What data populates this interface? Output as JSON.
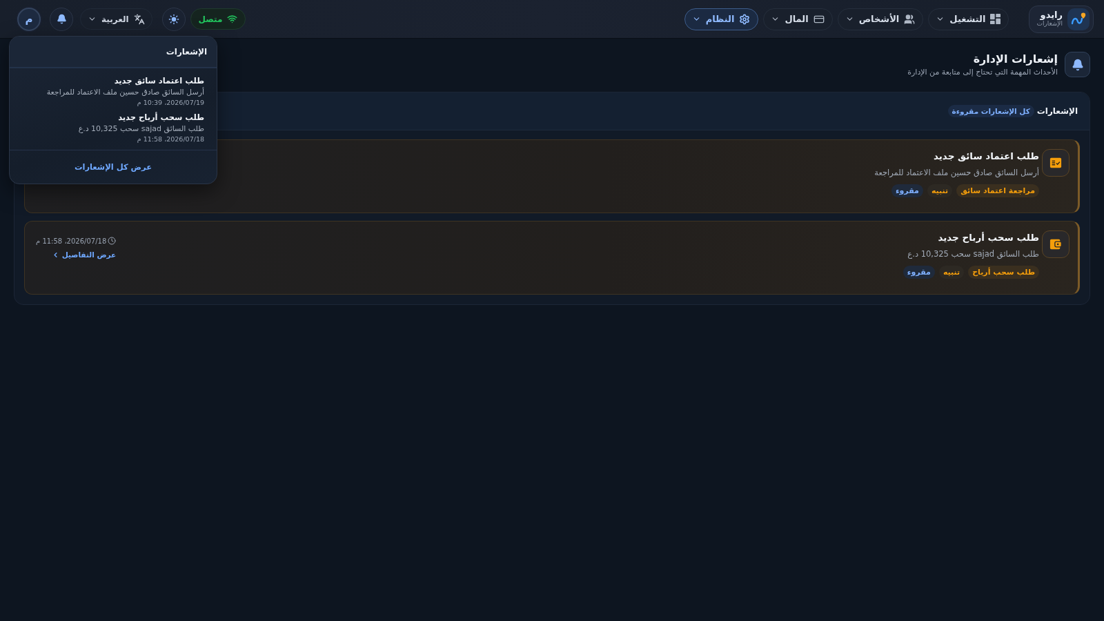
{
  "topbar": {
    "brand": {
      "name": "رايدو",
      "subtitle": "الإشعارات"
    },
    "nav": [
      {
        "label": "التشغيل",
        "selected": false
      },
      {
        "label": "الأشخاص",
        "selected": false
      },
      {
        "label": "المال",
        "selected": false
      },
      {
        "label": "النظام",
        "selected": true
      }
    ],
    "status": {
      "label": "متصل"
    },
    "language": {
      "label": "العربية"
    },
    "avatar": {
      "initial": "م"
    }
  },
  "notifications_menu": {
    "title": "الإشعارات",
    "items": [
      {
        "title": "طلب اعتماد سائق جديد",
        "message": "أرسل السائق صادق حسين ملف الاعتماد للمراجعة",
        "time": "2026/07/19، 10:39 م"
      },
      {
        "title": "طلب سحب أرباح جديد",
        "message": "طلب السائق sajad سحب 10,325 د.ع",
        "time": "2026/07/18، 11:58 م"
      }
    ],
    "footer_link": "عرض كل الإشعارات"
  },
  "page_header": {
    "title": "إشعارات الإدارة",
    "subtitle": "الأحداث المهمة التي تحتاج إلى متابعة من الإدارة"
  },
  "panel": {
    "title": "الإشعارات",
    "badge": "كل الإشعارات مقروءة",
    "notifications": [
      {
        "kind": "approval",
        "title": "طلب اعتماد سائق جديد",
        "message": "أرسل السائق صادق حسين ملف الاعتماد للمراجعة",
        "tags": [
          {
            "kind": "category",
            "label": "مراجعة اعتماد سائق"
          },
          {
            "kind": "alert",
            "label": "تنبيه"
          },
          {
            "kind": "read",
            "label": "مقروء"
          }
        ]
      },
      {
        "kind": "withdrawal",
        "title": "طلب سحب أرباح جديد",
        "message": "طلب السائق sajad سحب 10,325 د.ع",
        "tags": [
          {
            "kind": "category",
            "label": "طلب سحب أرباح"
          },
          {
            "kind": "alert",
            "label": "تنبيه"
          },
          {
            "kind": "read",
            "label": "مقروء"
          }
        ],
        "time": "2026/07/18، 11:58 م",
        "details_link": "عرض التفاصيل"
      }
    ]
  }
}
